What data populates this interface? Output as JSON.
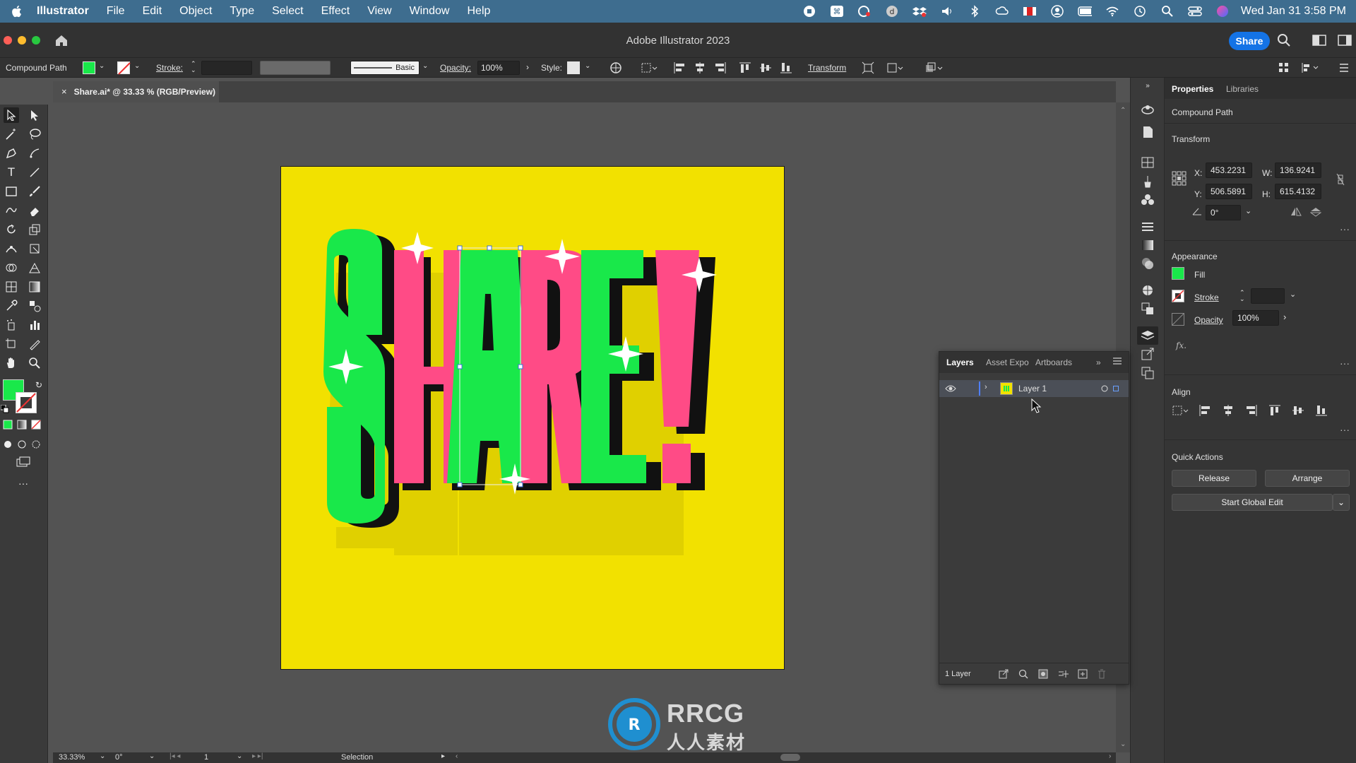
{
  "menubar": {
    "app": "Illustrator",
    "items": [
      "File",
      "Edit",
      "Object",
      "Type",
      "Select",
      "Effect",
      "View",
      "Window",
      "Help"
    ],
    "clock": "Wed Jan 31  3:58 PM"
  },
  "titlebar": {
    "title": "Adobe Illustrator 2023",
    "share_label": "Share"
  },
  "controlbar": {
    "selection_type": "Compound Path",
    "fill_color": "#19e84a",
    "stroke_label": "Stroke:",
    "brush_label": "Basic",
    "opacity_label": "Opacity:",
    "opacity_value": "100%",
    "style_label": "Style:",
    "transform_label": "Transform"
  },
  "document_tab": {
    "title": "Share.ai* @ 33.33 % (RGB/Preview)"
  },
  "artwork": {
    "text": "SHARE!",
    "background_color": "#f2e100",
    "swatches": [
      "#f2e100",
      "#ff4b86",
      "#19e84a",
      "#0a0a0a",
      "#ffffff"
    ]
  },
  "properties": {
    "tabs": [
      "Properties",
      "Libraries"
    ],
    "selection": "Compound Path",
    "transform_title": "Transform",
    "x_label": "X:",
    "x_value": "453.2231",
    "y_label": "Y:",
    "y_value": "506.5891",
    "w_label": "W:",
    "w_value": "136.9241",
    "h_label": "H:",
    "h_value": "615.4132",
    "angle_value": "0°",
    "appearance_title": "Appearance",
    "fill_label": "Fill",
    "stroke_label": "Stroke",
    "opacity_label": "Opacity",
    "opacity_value": "100%",
    "fx_label": "fx.",
    "align_title": "Align",
    "quick_actions_title": "Quick Actions",
    "release_label": "Release",
    "arrange_label": "Arrange",
    "global_edit_label": "Start Global Edit"
  },
  "layers_panel": {
    "tabs": [
      "Layers",
      "Asset Expo",
      "Artboards"
    ],
    "layer_name": "Layer 1",
    "count": "1 Layer"
  },
  "statusbar": {
    "zoom": "33.33%",
    "rotation": "0°",
    "artboard": "1",
    "tool": "Selection"
  },
  "watermark": {
    "line1": "RRCG",
    "line2": "人人素材"
  }
}
